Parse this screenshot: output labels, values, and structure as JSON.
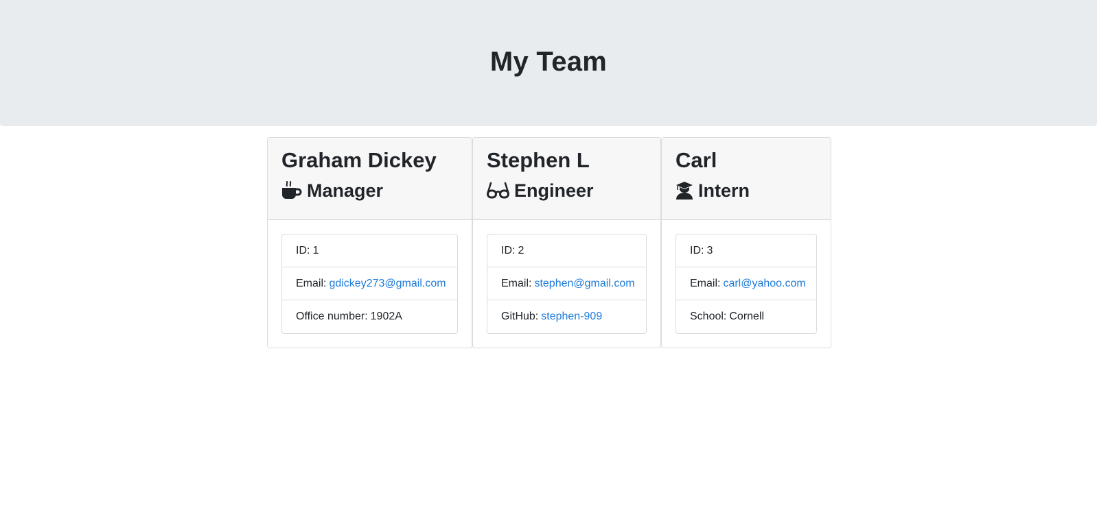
{
  "header": {
    "title": "My Team"
  },
  "team": [
    {
      "name": "Graham Dickey",
      "role": "Manager",
      "icon": "mug-hot-icon",
      "id_label": "ID:",
      "id": "1",
      "email_label": "Email:",
      "email": "gdickey273@gmail.com",
      "extra_label": "Office number:",
      "extra_value": "1902A"
    },
    {
      "name": "Stephen L",
      "role": "Engineer",
      "icon": "glasses-icon",
      "id_label": "ID:",
      "id": "2",
      "email_label": "Email:",
      "email": "stephen@gmail.com",
      "extra_label": "GitHub:",
      "extra_value": "stephen-909"
    },
    {
      "name": "Carl",
      "role": "Intern",
      "icon": "user-graduate-icon",
      "id_label": "ID:",
      "id": "3",
      "email_label": "Email:",
      "email": "carl@yahoo.com",
      "extra_label": "School:",
      "extra_value": "Cornell"
    }
  ],
  "colors": {
    "jumbotron_bg": "#e9ecef",
    "link": "#1e7bd9",
    "text": "#212529",
    "card_header_bg": "#f7f7f7"
  }
}
